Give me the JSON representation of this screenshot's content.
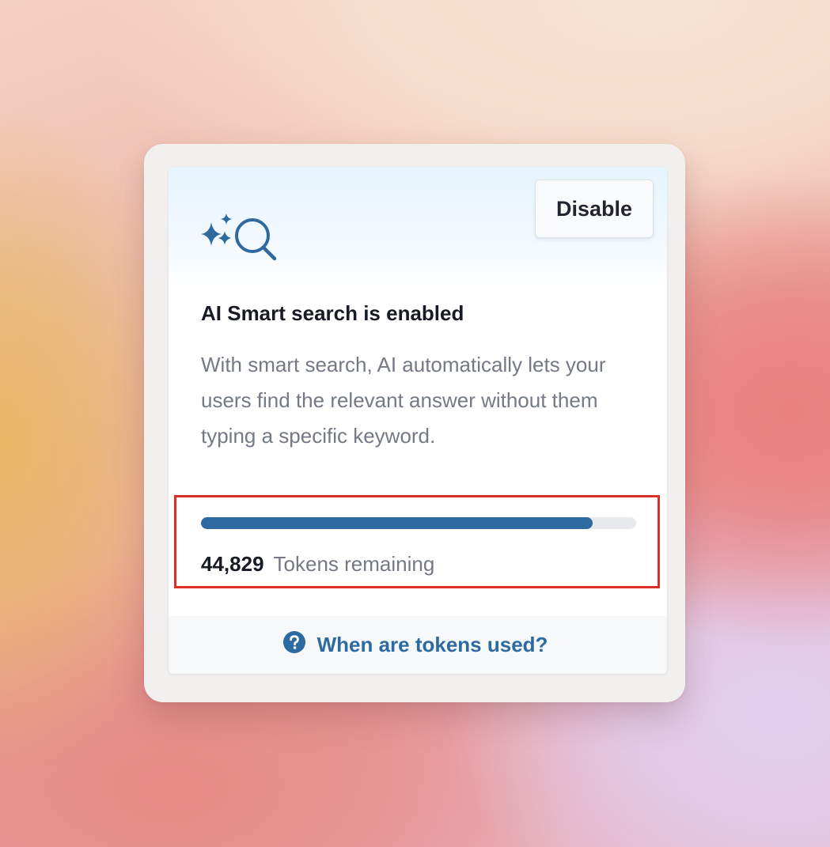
{
  "card": {
    "title": "AI Smart search is enabled",
    "description": "With smart search, AI automatically lets your users find the relevant answer without them typing a specific keyword.",
    "disable_label": "Disable",
    "feature_icon": "sparkle-search-icon"
  },
  "usage": {
    "progress_fraction": 0.9,
    "token_count": "44,829",
    "token_label": "Tokens remaining"
  },
  "footer": {
    "link_label": "When are tokens used?",
    "help_icon": "question-circle-icon"
  },
  "colors": {
    "accent": "#2e69a0",
    "link": "#2d6aa2",
    "highlight": "#dc2e24",
    "track": "#e7e9ed"
  }
}
